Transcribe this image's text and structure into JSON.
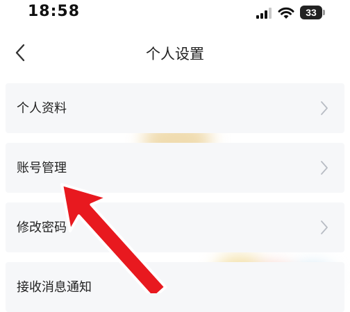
{
  "status_bar": {
    "time": "18:58",
    "battery_level": "33",
    "icons": [
      "cellular-signal-icon",
      "wifi-icon",
      "battery-icon"
    ]
  },
  "nav": {
    "title": "个人设置",
    "back_icon": "chevron-left-icon"
  },
  "settings": {
    "items": [
      {
        "label": "个人资料"
      },
      {
        "label": "账号管理"
      },
      {
        "label": "修改密码"
      },
      {
        "label": "接收消息通知"
      }
    ]
  },
  "annotation": {
    "arrow_color": "#e8191f",
    "target": "账号管理"
  },
  "colors": {
    "row_background": "#f6f7f9",
    "text": "#222222",
    "chevron": "#b8bcc4"
  }
}
